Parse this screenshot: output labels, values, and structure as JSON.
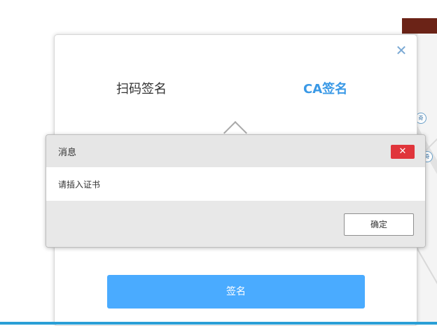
{
  "sign_dialog": {
    "close_glyph": "✕",
    "tabs": [
      {
        "label": "扫码签名"
      },
      {
        "label": "CA签名"
      }
    ],
    "sign_button_label": "签名"
  },
  "message_dialog": {
    "title": "消息",
    "close_glyph": "✕",
    "message": "请插入证书",
    "ok_label": "确定"
  },
  "background": {
    "badge_glyph": "奇"
  },
  "colors": {
    "accent_blue": "#4aabff",
    "tab_active": "#3a99e6",
    "close_red": "#e0353b",
    "bottom_line": "#2a9fd6"
  }
}
